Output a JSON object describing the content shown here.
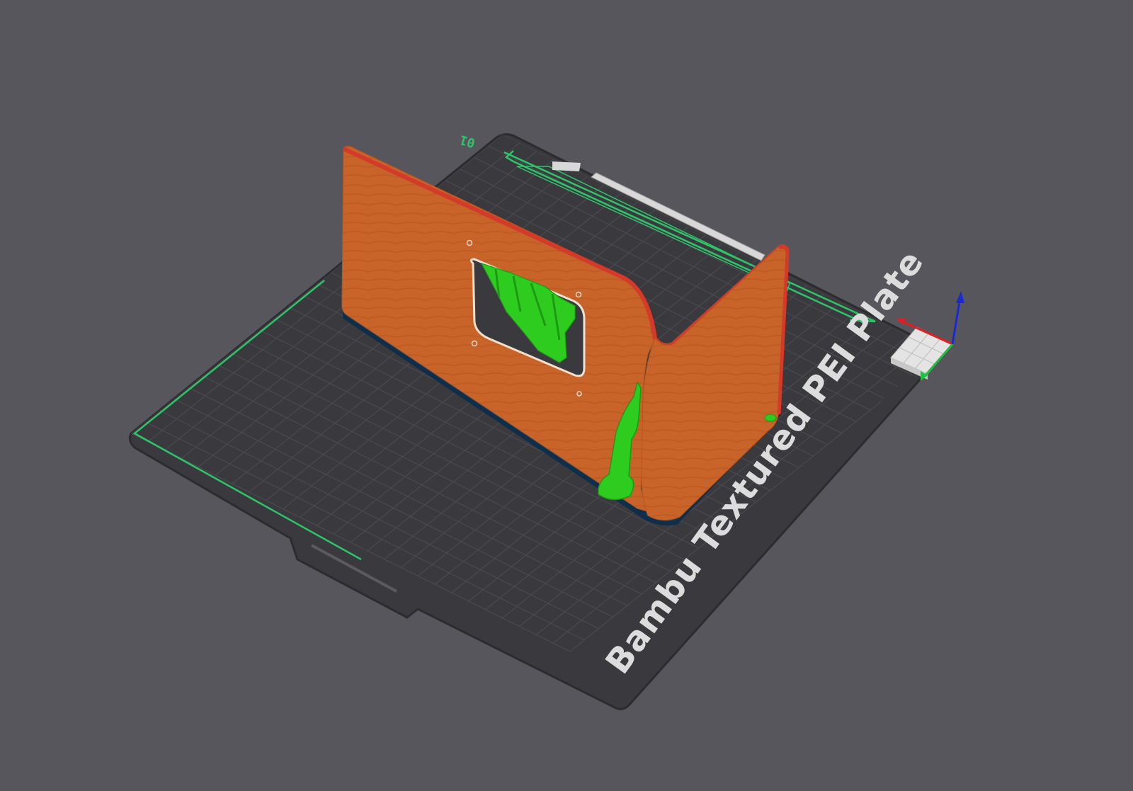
{
  "app": {
    "view": "3D preview"
  },
  "plate": {
    "brand_label": "Bambu Textured PEI Plate",
    "plate_number": "01"
  },
  "model": {
    "part_color": "#c8642a",
    "edge_color": "#d43a2a",
    "support_color": "#2ecc1f",
    "brim_color": "#143a5c"
  },
  "colors": {
    "background": "#57565c",
    "plate": "#3a3a3e",
    "grid": "#4c4c52",
    "boundary": "#2fc46a",
    "axis_x": "#e02020",
    "axis_y": "#22c040",
    "axis_z": "#1a2ad0"
  },
  "view_cube": {
    "icon": "view-cube-icon"
  }
}
